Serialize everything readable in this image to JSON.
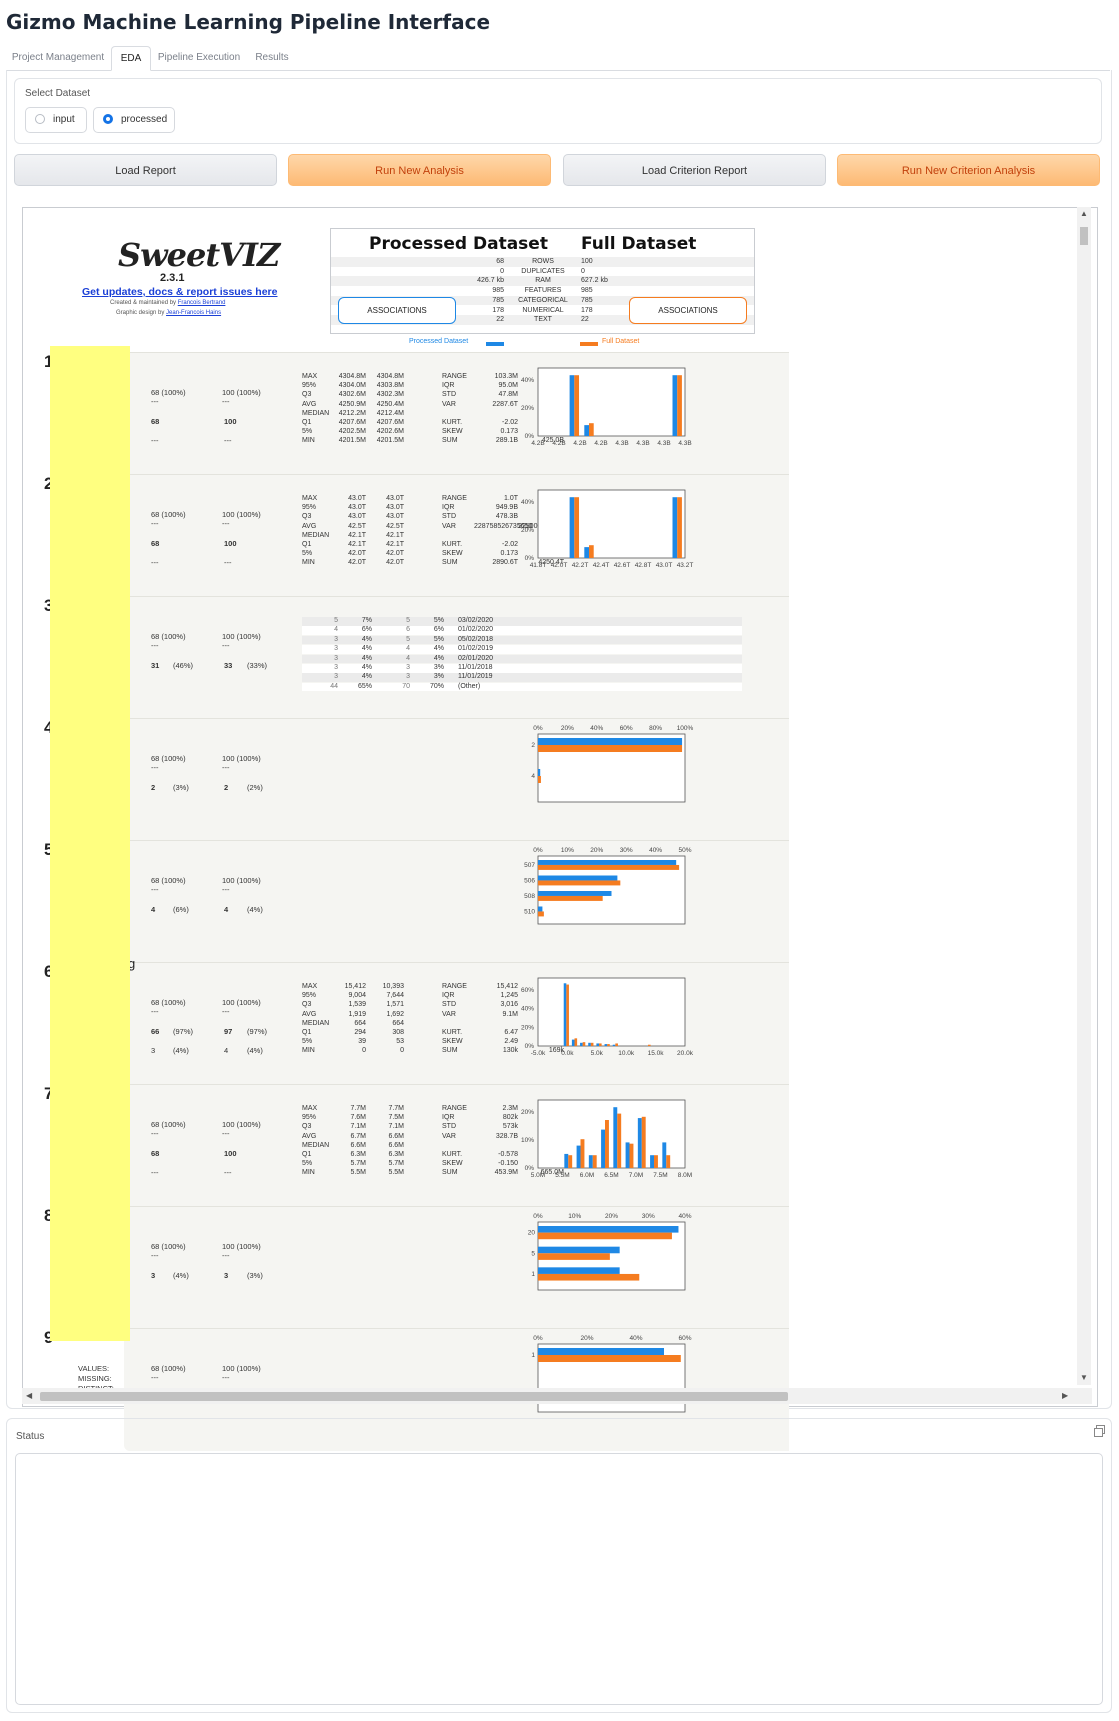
{
  "app_title": "Gizmo Machine Learning Pipeline Interface",
  "tabs": [
    "Project Management",
    "EDA",
    "Pipeline Execution",
    "Results"
  ],
  "active_tab": "EDA",
  "dataset_select": {
    "label": "Select Dataset",
    "options": [
      "input",
      "processed"
    ],
    "selected": "processed"
  },
  "buttons": {
    "load_report": "Load Report",
    "run_analysis": "Run New Analysis",
    "load_criterion": "Load Criterion Report",
    "run_criterion": "Run New Criterion Analysis"
  },
  "report": {
    "logo": "SweetVIZ",
    "version": "2.3.1",
    "link": "Get updates, docs & report issues here",
    "credit1": "Created & maintained by",
    "credit1_name": "Francois Bertrand",
    "credit2": "Graphic design by",
    "credit2_name": "Jean-Francois Hains",
    "summary": {
      "left_title": "Processed Dataset",
      "right_title": "Full Dataset",
      "rows": [
        {
          "label": "ROWS",
          "left": "68",
          "right": "100"
        },
        {
          "label": "DUPLICATES",
          "left": "0",
          "right": "0"
        },
        {
          "label": "RAM",
          "left": "426.7 kb",
          "right": "627.2 kb"
        },
        {
          "label": "FEATURES",
          "left": "985",
          "right": "985"
        },
        {
          "label": "CATEGORICAL",
          "left": "785",
          "right": "785"
        },
        {
          "label": "NUMERICAL",
          "left": "178",
          "right": "178"
        },
        {
          "label": "TEXT",
          "left": "22",
          "right": "22"
        }
      ],
      "associations": "ASSOCIATIONS"
    },
    "legend": {
      "left": "Processed Dataset",
      "right": "Full Dataset"
    },
    "colors": {
      "processed": "#1e88e5",
      "full": "#f57c20"
    }
  },
  "features": [
    {
      "num": "1",
      "type": "numeric",
      "values": [
        "68 (100%)",
        "100 (100%)"
      ],
      "missing": [
        "---",
        "---"
      ],
      "distinct": [
        "68",
        "100"
      ],
      "zeros": [
        "---",
        "---"
      ],
      "stats_a": [
        [
          "MAX",
          "4304.8M",
          "4304.8M"
        ],
        [
          "95%",
          "4304.0M",
          "4303.8M"
        ],
        [
          "Q3",
          "4302.6M",
          "4302.3M"
        ],
        [
          "AVG",
          "4250.9M",
          "4250.4M"
        ],
        [
          "MEDIAN",
          "4212.2M",
          "4212.4M"
        ],
        [
          "Q1",
          "4207.6M",
          "4207.6M"
        ],
        [
          "5%",
          "4202.5M",
          "4202.6M"
        ],
        [
          "MIN",
          "4201.5M",
          "4201.5M"
        ]
      ],
      "stats_b": [
        [
          "RANGE",
          "103.3M",
          "103.3M"
        ],
        [
          "IQR",
          "95.0M",
          "94.8M"
        ],
        [
          "STD",
          "47.8M",
          "47.5M"
        ],
        [
          "VAR",
          "2287.6T",
          "2255.0T"
        ],
        [
          "",
          "",
          " "
        ],
        [
          "KURT.",
          "-2.02",
          "-1.99"
        ],
        [
          "SKEW",
          "0.173",
          "0.196"
        ],
        [
          "SUM",
          "289.1B",
          "425.0B"
        ]
      ],
      "chart": {
        "kind": "hist",
        "yticks": [
          "40%",
          "20%",
          "0%"
        ],
        "xticks": [
          "4.2B",
          "4.2B",
          "4.2B",
          "4.2B",
          "4.3B",
          "4.3B",
          "4.3B",
          "4.3B"
        ],
        "bars": [
          [
            0,
            0
          ],
          [
            0,
            0
          ],
          [
            0.95,
            0.95
          ],
          [
            0.17,
            0.2
          ],
          [
            0,
            0
          ],
          [
            0,
            0
          ],
          [
            0,
            0
          ],
          [
            0,
            0
          ],
          [
            0,
            0
          ],
          [
            0.95,
            0.95
          ]
        ]
      }
    },
    {
      "num": "2",
      "type": "numeric",
      "values": [
        "68 (100%)",
        "100 (100%)"
      ],
      "missing": [
        "---",
        "---"
      ],
      "distinct": [
        "68",
        "100"
      ],
      "zeros": [
        "---",
        "---"
      ],
      "stats_a": [
        [
          "MAX",
          "43.0T",
          "43.0T"
        ],
        [
          "95%",
          "43.0T",
          "43.0T"
        ],
        [
          "Q3",
          "43.0T",
          "43.0T"
        ],
        [
          "AVG",
          "42.5T",
          "42.5T"
        ],
        [
          "MEDIAN",
          "42.1T",
          "42.1T"
        ],
        [
          "Q1",
          "42.1T",
          "42.1T"
        ],
        [
          "5%",
          "42.0T",
          "42.0T"
        ],
        [
          "MIN",
          "42.0T",
          "42.0T"
        ]
      ],
      "stats_b": [
        [
          "RANGE",
          "1.0T",
          "1.0T"
        ],
        [
          "IQR",
          "949.9B",
          "947.7B"
        ],
        [
          "STD",
          "478.3B",
          "474.9B"
        ],
        [
          "VAR",
          "228758526735650",
          "225003136818.6T"
        ],
        [
          "",
          "",
          " "
        ],
        [
          "KURT.",
          "-2.02",
          "-1.99"
        ],
        [
          "SKEW",
          "0.173",
          "0.196"
        ],
        [
          "SUM",
          "2890.6T",
          "4250.4T"
        ]
      ],
      "chart": {
        "kind": "hist",
        "yticks": [
          "40%",
          "20%",
          "0%"
        ],
        "xticks": [
          "41.8T",
          "42.0T",
          "42.2T",
          "42.4T",
          "42.6T",
          "42.8T",
          "43.0T",
          "43.2T"
        ],
        "bars": [
          [
            0,
            0
          ],
          [
            0,
            0
          ],
          [
            0.95,
            0.95
          ],
          [
            0.17,
            0.2
          ],
          [
            0,
            0
          ],
          [
            0,
            0
          ],
          [
            0,
            0
          ],
          [
            0,
            0
          ],
          [
            0,
            0
          ],
          [
            0.95,
            0.95
          ]
        ]
      }
    },
    {
      "num": "3",
      "type": "text",
      "values": [
        "68 (100%)",
        "100 (100%)"
      ],
      "missing": [
        "---",
        "---"
      ],
      "distinct": [
        "31",
        "33"
      ],
      "distinct_pct": [
        "(46%)",
        "(33%)"
      ],
      "table": [
        [
          "5",
          "7%",
          "5",
          "5%",
          "03/02/2020"
        ],
        [
          "4",
          "6%",
          "6",
          "6%",
          "01/02/2020"
        ],
        [
          "3",
          "4%",
          "5",
          "5%",
          "05/02/2018"
        ],
        [
          "3",
          "4%",
          "4",
          "4%",
          "01/02/2019"
        ],
        [
          "3",
          "4%",
          "4",
          "4%",
          "02/01/2020"
        ],
        [
          "3",
          "4%",
          "3",
          "3%",
          "11/01/2018"
        ],
        [
          "3",
          "4%",
          "3",
          "3%",
          "11/01/2019"
        ],
        [
          "44",
          "65%",
          "70",
          "70%",
          "(Other)"
        ]
      ]
    },
    {
      "num": "4",
      "type": "cat",
      "values": [
        "68 (100%)",
        "100 (100%)"
      ],
      "missing": [
        "---",
        "---"
      ],
      "distinct": [
        "2",
        "2"
      ],
      "distinct_pct": [
        "(3%)",
        "(2%)"
      ],
      "chart": {
        "kind": "hbar",
        "xticks": [
          "0%",
          "20%",
          "40%",
          "60%",
          "80%",
          "100%"
        ],
        "max": 100,
        "cats": [
          {
            "label": "2",
            "a": 98,
            "b": 98
          },
          {
            "label": "4",
            "a": 1.5,
            "b": 2
          }
        ]
      }
    },
    {
      "num": "5",
      "type": "cat",
      "values": [
        "68 (100%)",
        "100 (100%)"
      ],
      "missing": [
        "---",
        "---"
      ],
      "distinct": [
        "4",
        "4"
      ],
      "distinct_pct": [
        "(6%)",
        "(4%)"
      ],
      "chart": {
        "kind": "hbar",
        "xticks": [
          "0%",
          "10%",
          "20%",
          "30%",
          "40%",
          "50%"
        ],
        "max": 50,
        "cats": [
          {
            "label": "507",
            "a": 47,
            "b": 48
          },
          {
            "label": "506",
            "a": 27,
            "b": 28
          },
          {
            "label": "508",
            "a": 25,
            "b": 22
          },
          {
            "label": "510",
            "a": 1.5,
            "b": 2
          }
        ]
      }
    },
    {
      "num": "6",
      "extra": "g",
      "type": "numeric",
      "values": [
        "68 (100%)",
        "100 (100%)"
      ],
      "missing": [
        "---",
        "---"
      ],
      "distinct": [
        "66",
        "97"
      ],
      "distinct_pct": [
        "(97%)",
        "(97%)"
      ],
      "zeros": [
        "3",
        "4"
      ],
      "zeros_pct": [
        "(4%)",
        "(4%)"
      ],
      "stats_a": [
        [
          "MAX",
          "15,412",
          "10,393"
        ],
        [
          "95%",
          "9,004",
          "7,644"
        ],
        [
          "Q3",
          "1,539",
          "1,571"
        ],
        [
          "AVG",
          "1,919",
          "1,692"
        ],
        [
          "MEDIAN",
          "664",
          "664"
        ],
        [
          "Q1",
          "294",
          "308"
        ],
        [
          "5%",
          "39",
          "53"
        ],
        [
          "MIN",
          "0",
          "0"
        ]
      ],
      "stats_b": [
        [
          "RANGE",
          "15,412",
          "10,393"
        ],
        [
          "IQR",
          "1,245",
          "1,263"
        ],
        [
          "STD",
          "3,016",
          "2,406"
        ],
        [
          "VAR",
          "9.1M",
          "5.8M"
        ],
        [
          "",
          "",
          " "
        ],
        [
          "KURT.",
          "6.47",
          "4.47"
        ],
        [
          "SKEW",
          "2.49",
          "2.22"
        ],
        [
          "SUM",
          "130k",
          "169k"
        ]
      ],
      "chart": {
        "kind": "hist",
        "yticks": [
          "60%",
          "40%",
          "20%",
          "0%"
        ],
        "xticks": [
          "-5.0k",
          "0.0k",
          "5.0k",
          "10.0k",
          "15.0k",
          "20.0k"
        ],
        "bars": [
          [
            0,
            0
          ],
          [
            0,
            0
          ],
          [
            0,
            0
          ],
          [
            0.98,
            0.96
          ],
          [
            0.1,
            0.12
          ],
          [
            0.05,
            0.06
          ],
          [
            0.05,
            0.05
          ],
          [
            0.04,
            0.04
          ],
          [
            0.03,
            0.03
          ],
          [
            0.02,
            0.04
          ],
          [
            0,
            0
          ],
          [
            0,
            0
          ],
          [
            0,
            0
          ],
          [
            0,
            0.02
          ],
          [
            0,
            0
          ],
          [
            0,
            0
          ],
          [
            0,
            0
          ],
          [
            0,
            0
          ]
        ]
      }
    },
    {
      "num": "7",
      "type": "numeric",
      "values": [
        "68 (100%)",
        "100 (100%)"
      ],
      "missing": [
        "---",
        "---"
      ],
      "distinct": [
        "68",
        "100"
      ],
      "zeros": [
        "---",
        "---"
      ],
      "stats_a": [
        [
          "MAX",
          "7.7M",
          "7.7M"
        ],
        [
          "95%",
          "7.6M",
          "7.5M"
        ],
        [
          "Q3",
          "7.1M",
          "7.1M"
        ],
        [
          "AVG",
          "6.7M",
          "6.6M"
        ],
        [
          "MEDIAN",
          "6.6M",
          "6.6M"
        ],
        [
          "Q1",
          "6.3M",
          "6.3M"
        ],
        [
          "5%",
          "5.7M",
          "5.7M"
        ],
        [
          "MIN",
          "5.5M",
          "5.5M"
        ]
      ],
      "stats_b": [
        [
          "RANGE",
          "2.3M",
          "2.3M"
        ],
        [
          "IQR",
          "802k",
          "791k"
        ],
        [
          "STD",
          "573k",
          "541k"
        ],
        [
          "VAR",
          "328.7B",
          "292.9B"
        ],
        [
          "",
          "",
          " "
        ],
        [
          "KURT.",
          "-0.578",
          "-0.555"
        ],
        [
          "SKEW",
          "-0.150",
          "-0.147"
        ],
        [
          "SUM",
          "453.9M",
          "665.0M"
        ]
      ],
      "chart": {
        "kind": "hist",
        "yticks": [
          "20%",
          "10%",
          "0%"
        ],
        "xticks": [
          "5.0M",
          "5.5M",
          "6.0M",
          "6.5M",
          "7.0M",
          "7.5M",
          "8.0M"
        ],
        "bars": [
          [
            0,
            0
          ],
          [
            0,
            0
          ],
          [
            0.22,
            0.2
          ],
          [
            0.35,
            0.45
          ],
          [
            0.2,
            0.2
          ],
          [
            0.6,
            0.75
          ],
          [
            0.95,
            0.85
          ],
          [
            0.4,
            0.38
          ],
          [
            0.78,
            0.8
          ],
          [
            0.2,
            0.2
          ],
          [
            0.4,
            0.2
          ],
          [
            0,
            0
          ]
        ]
      }
    },
    {
      "num": "8",
      "type": "cat",
      "values": [
        "68 (100%)",
        "100 (100%)"
      ],
      "missing": [
        "---",
        "---"
      ],
      "distinct": [
        "3",
        "3"
      ],
      "distinct_pct": [
        "(4%)",
        "(3%)"
      ],
      "chart": {
        "kind": "hbar",
        "xticks": [
          "0%",
          "10%",
          "20%",
          "30%",
          "40%"
        ],
        "max": 45,
        "cats": [
          {
            "label": "20",
            "a": 43,
            "b": 41
          },
          {
            "label": "5",
            "a": 25,
            "b": 22
          },
          {
            "label": "1",
            "a": 25,
            "b": 31
          }
        ]
      }
    },
    {
      "num": "9",
      "type": "cat",
      "labels": [
        "VALUES:",
        "MISSING:",
        "DISTINCT:"
      ],
      "values": [
        "68 (100%)",
        "100 (100%)"
      ],
      "missing": [
        "---",
        "---"
      ],
      "chart": {
        "kind": "hbar",
        "xticks": [
          "0%",
          "20%",
          "40%",
          "60%"
        ],
        "max": 70,
        "cats": [
          {
            "label": "1",
            "a": 60,
            "b": 68
          }
        ]
      }
    }
  ],
  "status": {
    "label": "Status",
    "value": ""
  }
}
